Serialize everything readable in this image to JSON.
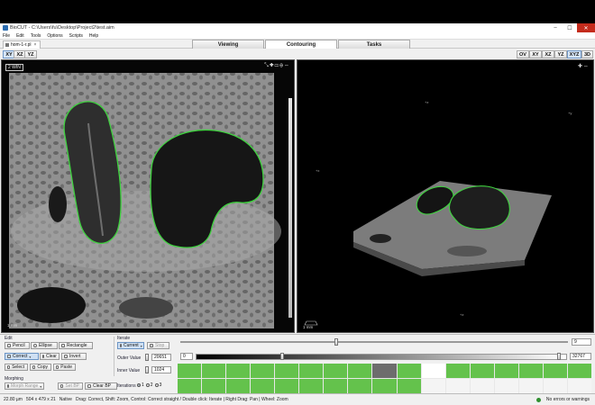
{
  "window": {
    "title": "BioCUT - C:\\Users\\fu\\Desktop\\Project2\\test.aim"
  },
  "menu": [
    "File",
    "Edit",
    "Tools",
    "Options",
    "Scripts",
    "Help"
  ],
  "file_tab": {
    "label": "hom-1-r.pl"
  },
  "mode_tabs": [
    "Viewing",
    "Contouring",
    "Tasks"
  ],
  "active_mode": "Contouring",
  "left_view_buttons": [
    "XY",
    "XZ",
    "YZ"
  ],
  "right_view_buttons": [
    "OV",
    "XY",
    "XZ",
    "YZ",
    "XYZ",
    "3D"
  ],
  "left_viewport": {
    "label": "2 WIN",
    "scale": "1 mm"
  },
  "right_viewport": {
    "scale": "1 mm"
  },
  "edit": {
    "title": "Edit",
    "pencil": "Pencil",
    "ellipse": "Ellipse",
    "rectangle": "Rectangle",
    "correct": "Correct",
    "clear": "Clear",
    "invert": "Invert",
    "select": "Select",
    "copy": "Copy",
    "paste": "Paste"
  },
  "morphing": {
    "title": "Morphing",
    "morph_range": "Morph Range",
    "set_bp": "Set BP",
    "clear_bp": "Clear BP"
  },
  "iterate": {
    "title": "Iterate",
    "current": "Current",
    "stop": "Stop",
    "outer_label": "Outer Value",
    "outer_value": "20651",
    "inner_label": "Inner Value",
    "inner_value": "1024",
    "iterations_label": "Iterations",
    "iterations_options": [
      "1",
      "2",
      "3"
    ],
    "iterations_selected": 1
  },
  "sliders": {
    "slice_value": "9",
    "range_min": "0",
    "range_max": "32767"
  },
  "status": {
    "zoom": "22.80 µm",
    "dims": "504 x 479 x 21",
    "mode": "Native",
    "hint": "Drag: Correct, Shift: Zoom, Control: Correct straight / Double click: Iterate | Right Drag: Pan | Wheel: Zoom",
    "message": "No errors or warnings"
  },
  "colors": {
    "contour": "#3fd23f",
    "iter_done": "#64c24c",
    "iter_current": "#6d6d6d"
  }
}
